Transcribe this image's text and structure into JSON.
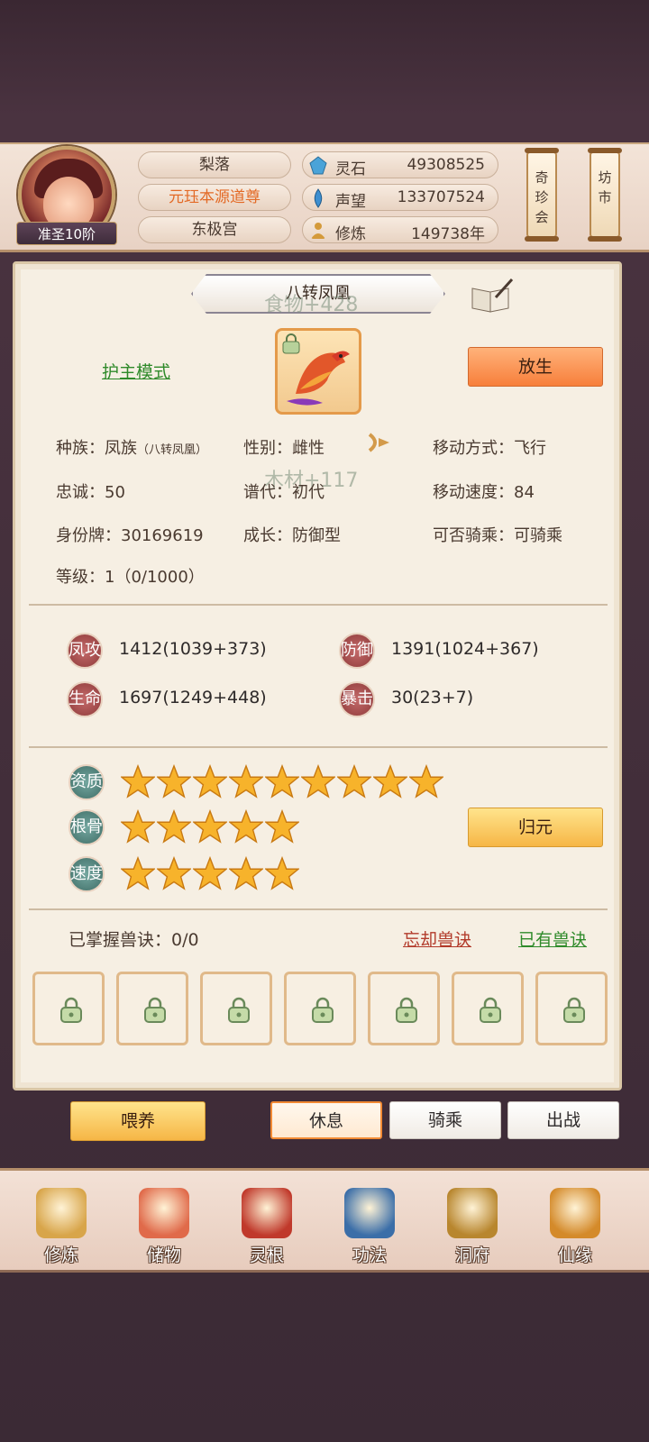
{
  "player": {
    "rank": "准圣10阶",
    "name": "梨落",
    "title": "元珏本源道尊",
    "sect": "东极宫"
  },
  "resources": [
    {
      "label": "灵石",
      "value": "49308525",
      "icon": "spirit-stone-icon",
      "color": "#4aa3d8"
    },
    {
      "label": "声望",
      "value": "133707524",
      "icon": "prestige-icon",
      "color": "#3e8fd0"
    },
    {
      "label": "修炼",
      "value": "149738年",
      "icon": "meditation-icon",
      "color": "#d49a3a"
    }
  ],
  "hang_buttons": {
    "treasure": "奇珍会",
    "market": "坊市"
  },
  "pet": {
    "name": "八转凤凰",
    "mode_link": "护主模式",
    "release_button": "放生",
    "floating_text_1": "食物+428",
    "floating_text_2": "木材+117",
    "info": {
      "race_label": "种族：凤族",
      "race_sub": "（八转凤凰）",
      "gender": "性别：雌性",
      "move_type": "移动方式：飞行",
      "loyalty": "忠诚：50",
      "generation": "谱代：初代",
      "move_speed": "移动速度：84",
      "id_tag": "身份牌：30169619",
      "growth": "成长：防御型",
      "rideable": "可否骑乘：可骑乘",
      "level": "等级：1（0/1000）"
    },
    "stats": [
      {
        "label": "凤攻",
        "value": "1412(1039+373)"
      },
      {
        "label": "防御",
        "value": "1391(1024+367)"
      },
      {
        "label": "生命",
        "value": "1697(1249+448)"
      },
      {
        "label": "暴击",
        "value": "30(23+7)"
      }
    ],
    "ratings": [
      {
        "label": "资质",
        "stars": 9
      },
      {
        "label": "根骨",
        "stars": 5
      },
      {
        "label": "速度",
        "stars": 5
      }
    ],
    "reset_button": "归元",
    "skills": {
      "mastered": "已掌握兽诀：0/0",
      "forget_link": "忘却兽诀",
      "owned_link": "已有兽诀",
      "slots": 7
    }
  },
  "actions": {
    "feed": "喂养",
    "rest": "休息",
    "ride": "骑乘",
    "battle": "出战"
  },
  "nav": [
    {
      "label": "修炼",
      "icon": "cultivate-icon",
      "color": "#d8a54a"
    },
    {
      "label": "储物",
      "icon": "storage-bag-icon",
      "color": "#e06a4a"
    },
    {
      "label": "灵根",
      "icon": "spirit-root-icon",
      "color": "#c0392b"
    },
    {
      "label": "功法",
      "icon": "scripture-book-icon",
      "color": "#3b6ea8"
    },
    {
      "label": "洞府",
      "icon": "cave-mansion-icon",
      "color": "#b8862e"
    },
    {
      "label": "仙缘",
      "icon": "gourd-icon",
      "color": "#d48a2a"
    }
  ]
}
